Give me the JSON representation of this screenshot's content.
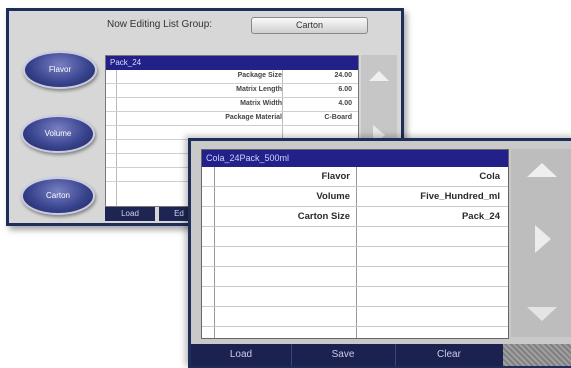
{
  "back_panel": {
    "header_label": "Now Editing List Group:",
    "header_value": "Carton",
    "side_buttons": [
      "Flavor",
      "Volume",
      "Carton"
    ],
    "table_title": "Pack_24",
    "rows": [
      {
        "key": "Package Size",
        "value": "24.00"
      },
      {
        "key": "Matrix Length",
        "value": "6.00"
      },
      {
        "key": "Matrix Width",
        "value": "4.00"
      },
      {
        "key": "Package Material",
        "value": "C-Board"
      }
    ],
    "bottom_buttons": [
      "Load",
      "Ed"
    ]
  },
  "front_panel": {
    "table_title": "Cola_24Pack_500ml",
    "rows": [
      {
        "key": "Flavor",
        "value": "Cola"
      },
      {
        "key": "Volume",
        "value": "Five_Hundred_ml"
      },
      {
        "key": "Carton Size",
        "value": "Pack_24"
      }
    ],
    "bottom_buttons": [
      "Load",
      "Save",
      "Clear"
    ]
  },
  "colors": {
    "frame": "#1f2e59",
    "title_bar": "#22218a",
    "button": "#1b2250"
  },
  "icons": [
    "scroll-up-icon",
    "scroll-right-icon",
    "scroll-down-icon"
  ]
}
